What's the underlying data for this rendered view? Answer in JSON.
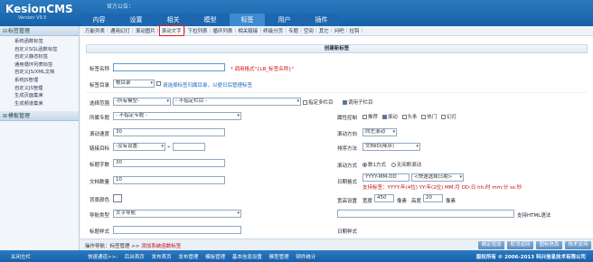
{
  "app": {
    "logo": "KesionCMS",
    "version": "Version V9.5",
    "site_label": "官方公告："
  },
  "nav": {
    "tabs": [
      "内容",
      "设置",
      "相关",
      "模型",
      "标签",
      "用户",
      "插件"
    ],
    "active": 4
  },
  "sidebar": {
    "section1": "标签管理",
    "items": [
      "系统函数标签",
      "自定义SQL函数标签",
      "自定义静态标签",
      "通用循环列表标签",
      "自定义JS/XML文档",
      "系统JS管理",
      "自定义JS管理",
      "生成页面集束",
      "生成频道集束"
    ],
    "section2": "模板管理"
  },
  "subtabs": [
    "万能列表",
    "通用幻灯",
    "滚动图片",
    "滚动文字",
    "下拉列表",
    "循环列表",
    "相关链接",
    "终级分页",
    "专题",
    "空间",
    "其它",
    "问吧",
    "拉钩"
  ],
  "subtabs_highlight": 3,
  "panel_title": "创建新标签",
  "form": {
    "tag_name_label": "标签名称",
    "tag_name_value": "",
    "tag_name_hint": "* 调用格式\"{LB_标签名称}\"",
    "tag_dir_label": "标签目录",
    "tag_dir_value": "根目录",
    "tag_dir_hint": "请选择标签归属目录，以便日后管理标签",
    "scope_label": "选择范围",
    "scope_model": "-所有模型-",
    "scope_column": "- 不指定栏目 -",
    "specify_multi_label": "指定多栏目",
    "call_sub_label": "调用子栏目",
    "special_label": "所属专题",
    "special_value": "- 不指定专题 -",
    "attr_label": "属性控制",
    "attrs": [
      "推荐",
      "滚动",
      "头条",
      "热门",
      "幻灯"
    ],
    "scroll_speed_label": "滚动速度",
    "scroll_speed_value": "30",
    "scroll_dir_label": "滚动方向",
    "scroll_dir_value": "向左滚动",
    "link_target_label": "链接目标",
    "link_target_value": "-没有设置-",
    "link_target_extra": "",
    "sort_label": "排序方法",
    "sort_value": "文档ID(降序)",
    "title_chars_label": "标题字数",
    "title_chars_value": "30",
    "scroll_mode_label": "滚动方式",
    "scroll_mode_options": [
      "数1方式",
      "无间断滚动"
    ],
    "doc_count_label": "文档数量",
    "doc_count_value": "10",
    "date_format_label": "日期格式",
    "date_format_value": "YYYY-MM-DD",
    "date_format_select": "<快速选择日期>",
    "date_format_hint": "支持标签：YYYY:年(4位) YY:年(2位) MM:月 DD:日 hh:时 mm:分 ss:秒",
    "bgcolor_label": "背景颜色",
    "size_label": "宽高设置",
    "width_label": "宽度",
    "width_value": "450",
    "width_unit": "像素",
    "height_label": "高度",
    "height_value": "20",
    "height_unit": "像素",
    "nav_type_label": "导航类型",
    "nav_type_value": "文字导航",
    "nav_text_hint": "支持HTML语法",
    "title_style_label": "标题样式",
    "date_style_label": "日期样式"
  },
  "actionbar": {
    "breadcrumb_prefix": "操作导航：",
    "breadcrumb_main": "标签管理",
    "breadcrumb_arrow": ">>",
    "breadcrumb_current": "添加系统函数标签",
    "buttons": [
      "确定增加",
      "取消返回",
      "图标信息",
      "技术支持"
    ]
  },
  "footer": {
    "left": "关闭左栏",
    "quick_label": "快速通道>>:",
    "links": [
      "后台首页",
      "发布首页",
      "发布管理",
      "模板管理",
      "基本信息设置",
      "模型管理",
      "顿件统计"
    ],
    "copyright": "版权所有 © 2006-2013 科兴信息技术有限公司"
  }
}
